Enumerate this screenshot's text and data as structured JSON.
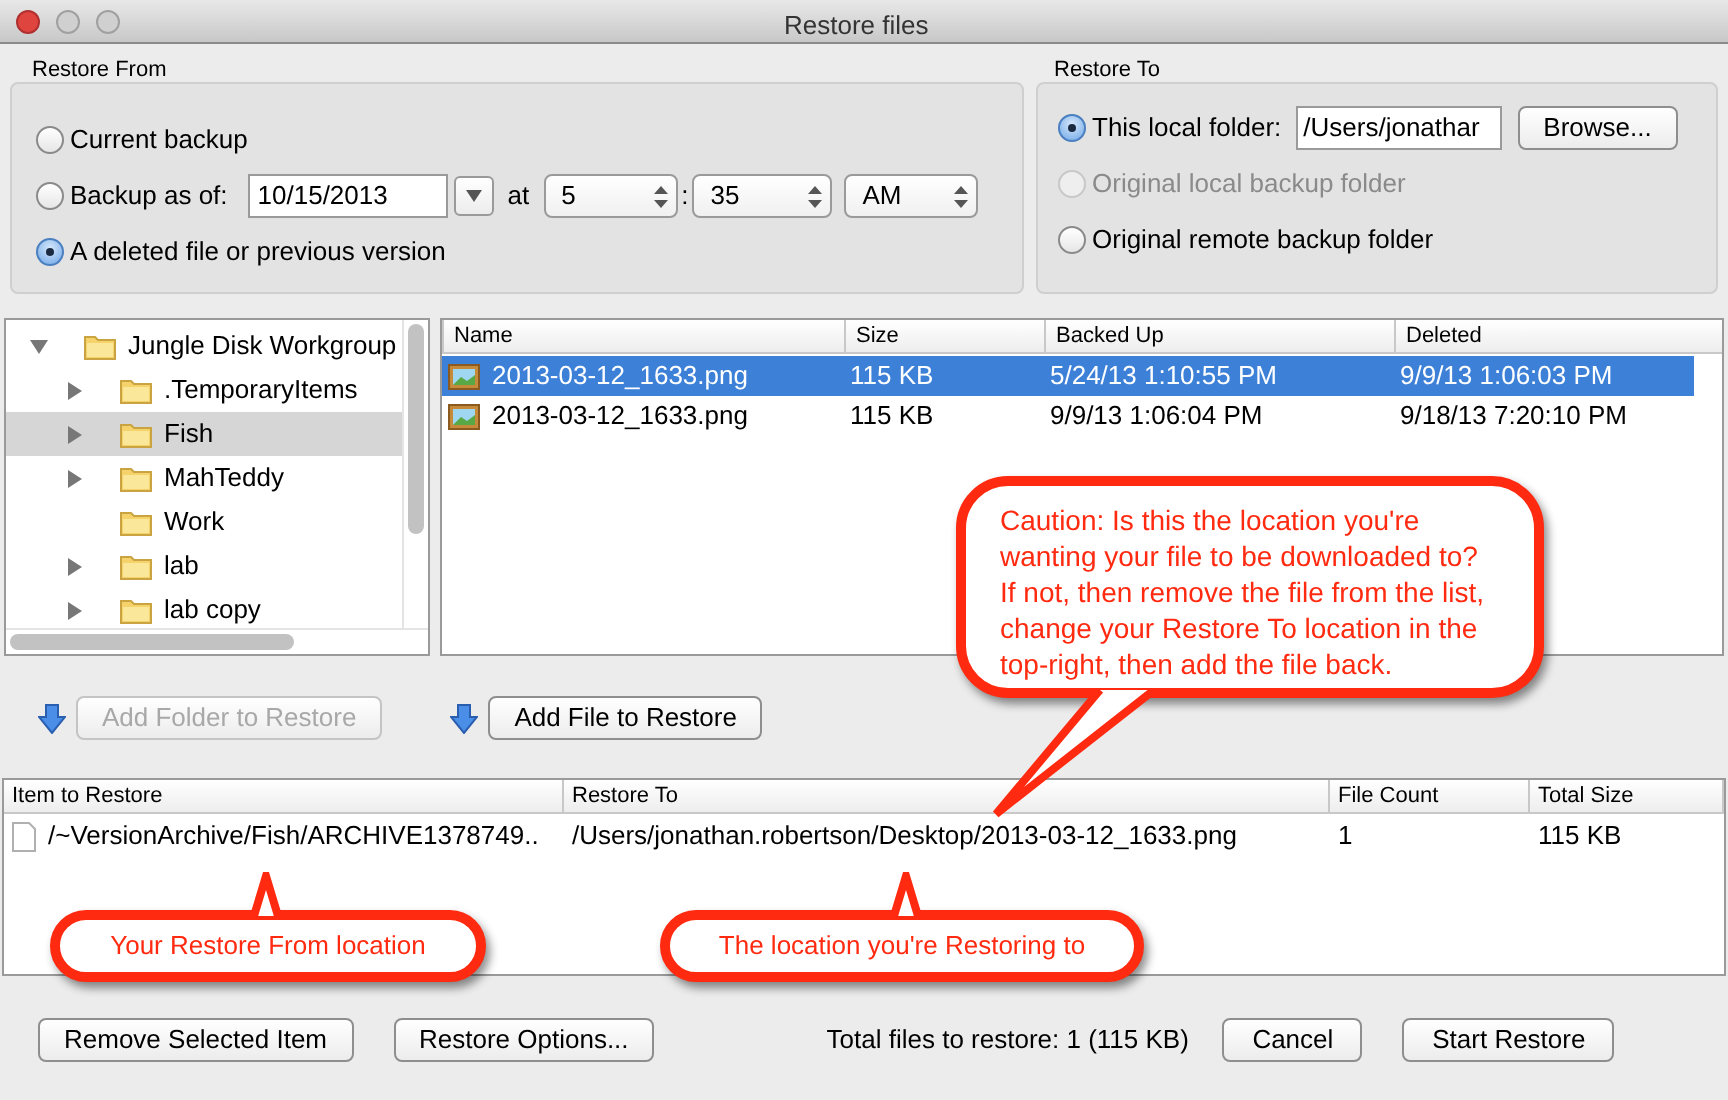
{
  "window": {
    "title": "Restore files"
  },
  "restore_from": {
    "label": "Restore From",
    "options": [
      {
        "kind": "plain",
        "label": "Current backup",
        "selected": false
      },
      {
        "kind": "date",
        "label": "Backup as of:",
        "selected": false,
        "date": "10/15/2013",
        "at": "at",
        "hour": "5",
        "colon": ":",
        "minute": "35",
        "ampm": "AM"
      },
      {
        "kind": "plain",
        "label": "A deleted file or previous version",
        "selected": true
      }
    ]
  },
  "restore_to": {
    "label": "Restore To",
    "options": [
      {
        "kind": "folder",
        "label": "This local folder:",
        "selected": true,
        "disabled": false,
        "path": "/Users/jonathar",
        "browse": "Browse..."
      },
      {
        "kind": "plain",
        "label": "Original local backup folder",
        "selected": false,
        "disabled": true
      },
      {
        "kind": "plain",
        "label": "Original remote backup folder",
        "selected": false,
        "disabled": false
      }
    ]
  },
  "tree": [
    {
      "label": "Jungle Disk Workgroup",
      "has_children": true,
      "expanded": true,
      "selected": false,
      "children": [
        {
          "label": ".TemporaryItems",
          "has_children": true,
          "expanded": false,
          "selected": false
        },
        {
          "label": "Fish",
          "has_children": true,
          "expanded": false,
          "selected": true
        },
        {
          "label": "MahTeddy",
          "has_children": true,
          "expanded": false,
          "selected": false
        },
        {
          "label": "Work",
          "has_children": false,
          "selected": false
        },
        {
          "label": "lab",
          "has_children": true,
          "expanded": false,
          "selected": false
        },
        {
          "label": "lab copy",
          "has_children": true,
          "expanded": false,
          "selected": false
        }
      ]
    }
  ],
  "file_list": {
    "columns": [
      "Name",
      "Size",
      "Backed Up",
      "Deleted"
    ],
    "rows": [
      {
        "cells": [
          "2013-03-12_1633.png",
          "115 KB",
          "5/24/13 1:10:55 PM",
          "9/9/13 1:06:03 PM"
        ],
        "selected": true
      },
      {
        "cells": [
          "2013-03-12_1633.png",
          "115 KB",
          "9/9/13 1:06:04 PM",
          "9/18/13 7:20:10 PM"
        ],
        "selected": false
      }
    ]
  },
  "add_buttons": [
    {
      "label": "Add Folder to Restore",
      "disabled": true
    },
    {
      "label": "Add File to Restore",
      "disabled": false
    }
  ],
  "restore_table": {
    "columns": [
      "Item to Restore",
      "Restore To",
      "File Count",
      "Total Size"
    ],
    "rows": [
      {
        "cells": [
          "/~VersionArchive/Fish/ARCHIVE1378749..",
          "/Users/jonathan.robertson/Desktop/2013-03-12_1633.png",
          "1",
          "115 KB"
        ]
      }
    ]
  },
  "footer": {
    "buttons_left": [
      "Remove Selected Item",
      "Restore Options..."
    ],
    "total": "Total files to restore: 1 (115 KB)",
    "buttons_right": [
      "Cancel",
      "Start Restore"
    ]
  },
  "annotations": [
    {
      "kind": "large",
      "text": "Caution: Is this the location you're wanting your file to be downloaded to? If not, then remove the file from the list, change your Restore To location in the top-right, then add the file back."
    },
    {
      "kind": "left",
      "text": "Your Restore From location"
    },
    {
      "kind": "right",
      "text": "The location you're Restoring to"
    }
  ]
}
